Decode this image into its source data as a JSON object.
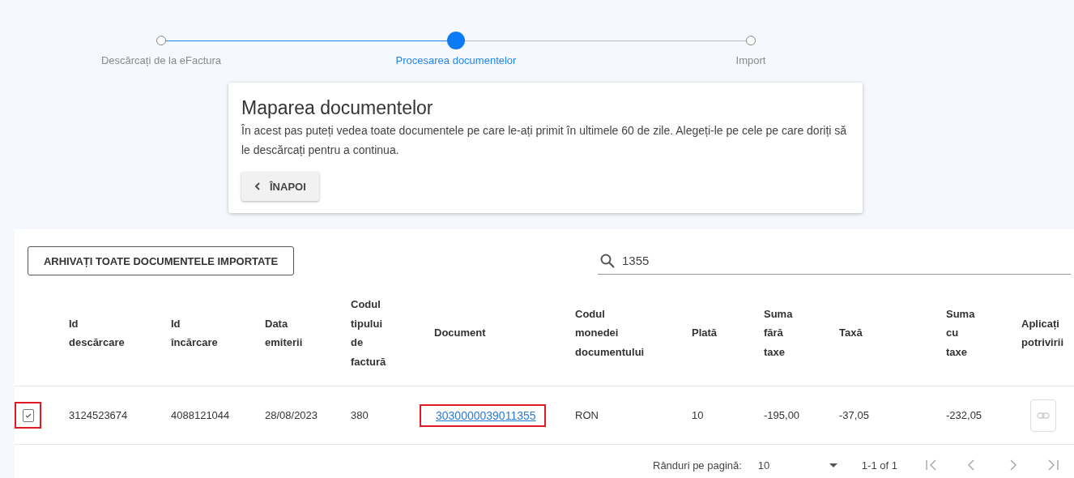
{
  "steps": [
    {
      "label": "Descărcați de la eFactura",
      "selected": false
    },
    {
      "label": "Procesarea documentelor",
      "selected": true
    },
    {
      "label": "Import",
      "selected": false
    }
  ],
  "card": {
    "title": "Maparea documentelor",
    "text": "În acest pas puteți vedea toate documentele pe care le-ați primit în ultimele 60 de zile. Alegeți-le pe cele pe care doriți să le descărcați pentru a continua.",
    "back_button": "ÎNAPOI"
  },
  "toolbar": {
    "archive_button": "ARHIVAȚI TOATE DOCUMENTELE IMPORTATE",
    "search_value": "1355"
  },
  "table": {
    "columns": [
      "Id descărcare",
      "Id încărcare",
      "Data emiterii",
      "Codul tipului de factură",
      "Document",
      "Codul monedei documentului",
      "Plată",
      "Suma fără taxe",
      "Taxă",
      "Suma cu taxe",
      "Aplicați potrivirii"
    ],
    "rows": [
      {
        "checked": true,
        "checkbox_highlighted": true,
        "document_highlighted": true,
        "cells": [
          "3124523674",
          "4088121044",
          "28/08/2023",
          "380",
          "3030000039011355",
          "RON",
          "10",
          "-195,00",
          "-37,05",
          "-232,05"
        ]
      }
    ]
  },
  "pagination": {
    "rows_per_page_label": "Rânduri pe pagină:",
    "rows_per_page": "10",
    "range": "1-1 of 1"
  }
}
